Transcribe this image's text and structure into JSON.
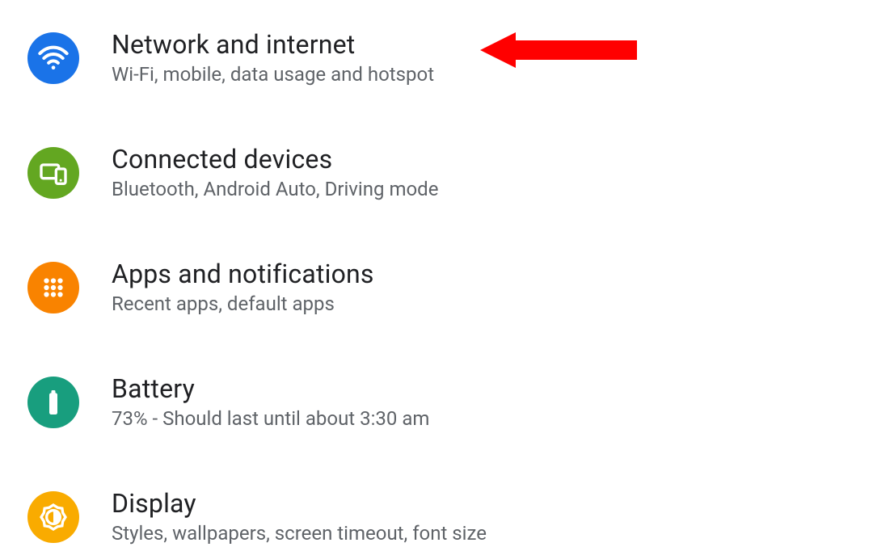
{
  "settings": {
    "items": [
      {
        "title": "Network and internet",
        "subtitle": "Wi-Fi, mobile, data usage and hotspot",
        "icon_color": "#1a73e8"
      },
      {
        "title": "Connected devices",
        "subtitle": "Bluetooth, Android Auto, Driving mode",
        "icon_color": "#63a721"
      },
      {
        "title": "Apps and notifications",
        "subtitle": "Recent apps, default apps",
        "icon_color": "#f98300"
      },
      {
        "title": "Battery",
        "subtitle": "73% - Should last until about 3:30 am",
        "icon_color": "#189e7e"
      },
      {
        "title": "Display",
        "subtitle": "Styles, wallpapers, screen timeout, font size",
        "icon_color": "#f9ab00"
      }
    ]
  },
  "annotation": {
    "type": "arrow-left",
    "color": "#ff0000",
    "target": "network-and-internet"
  }
}
